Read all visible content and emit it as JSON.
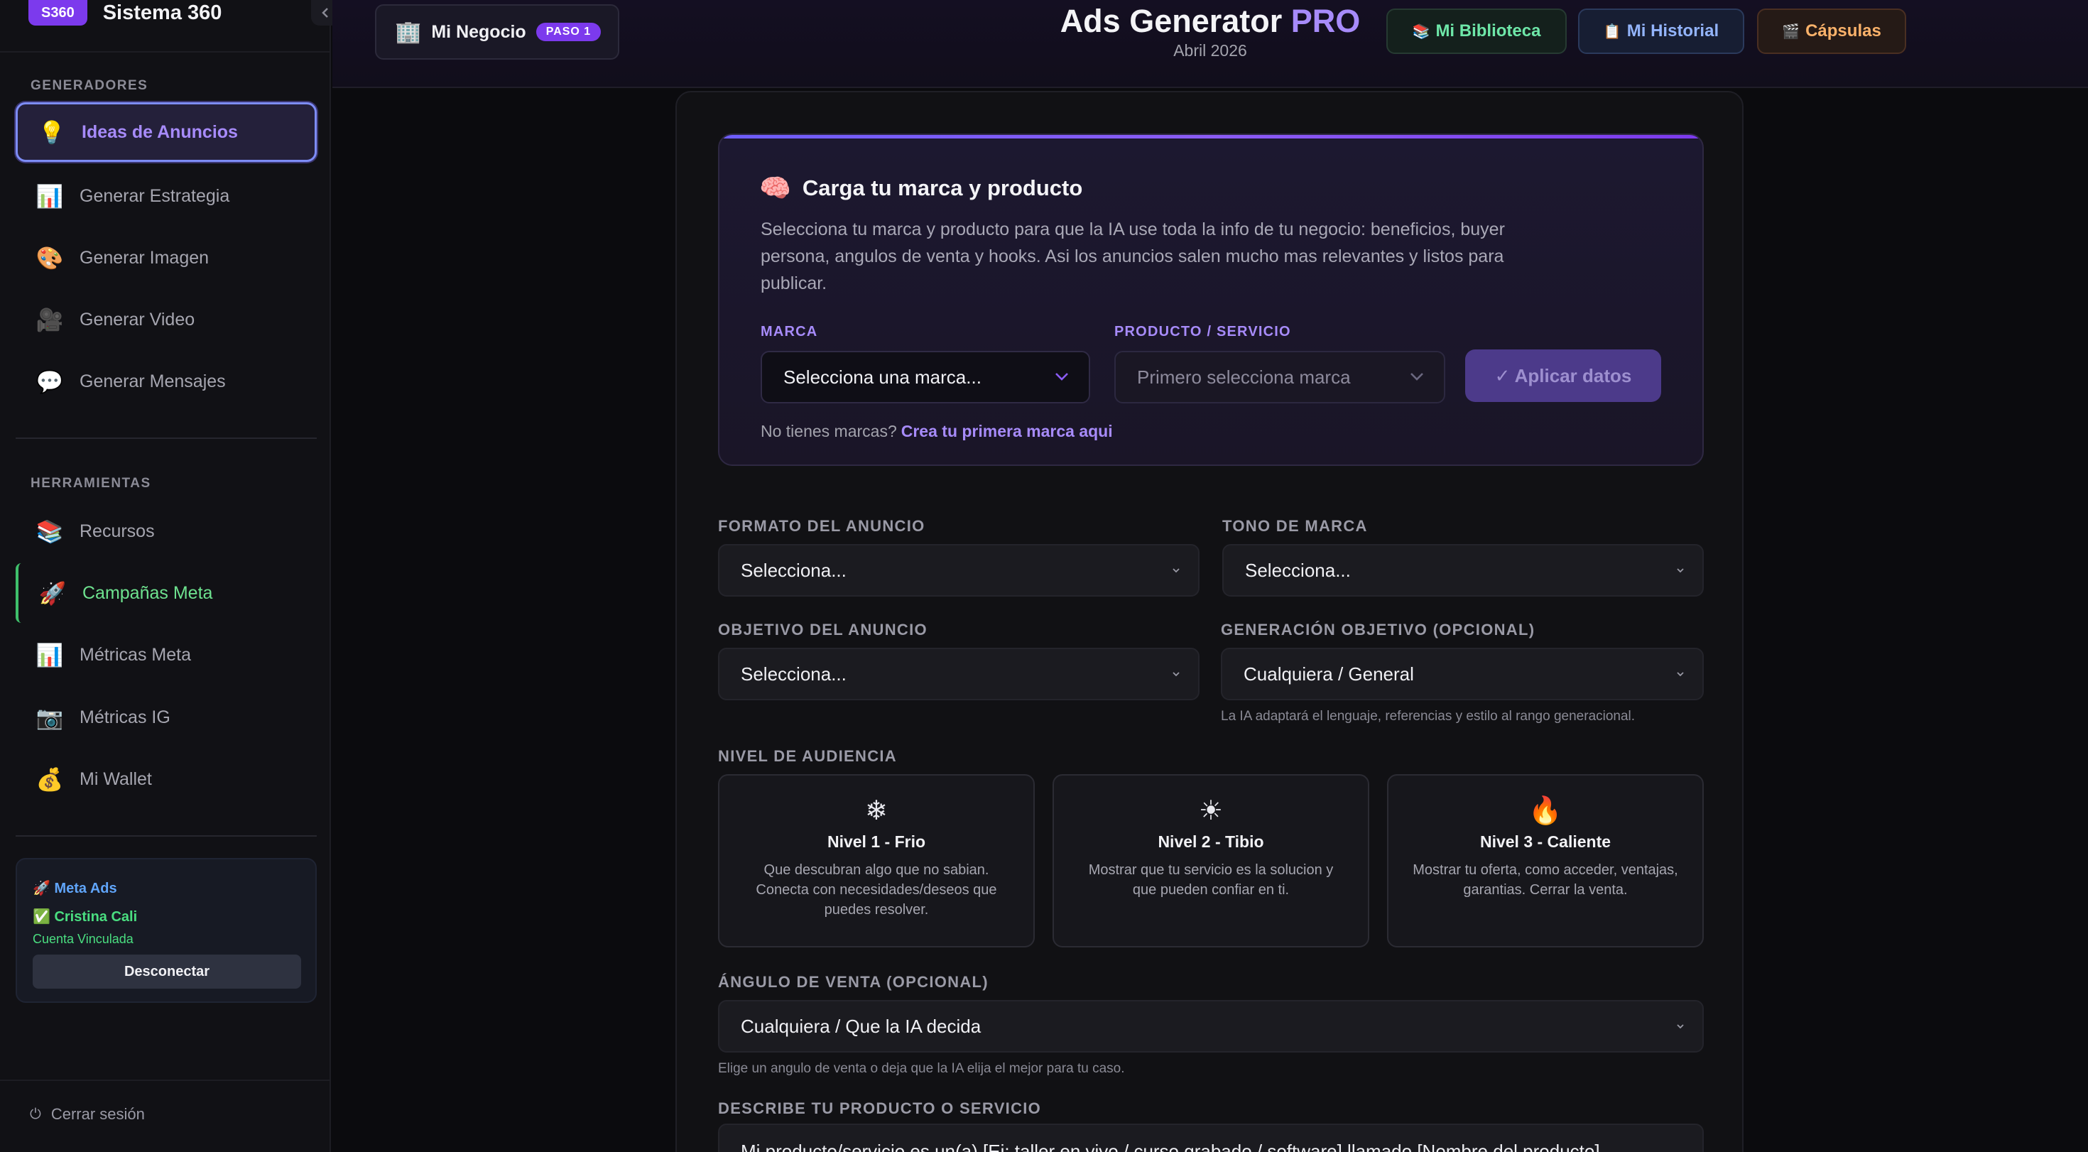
{
  "sidebar": {
    "brand_badge": "S360",
    "brand_name": "Sistema 360",
    "collapse_icon": "chevron-left-icon",
    "section_generators": "GENERADORES",
    "generators": [
      {
        "icon": "💡",
        "label": "Ideas de Anuncios",
        "active": true
      },
      {
        "icon": "📊",
        "label": "Generar Estrategia"
      },
      {
        "icon": "🎨",
        "label": "Generar Imagen"
      },
      {
        "icon": "🎥",
        "label": "Generar Video"
      },
      {
        "icon": "💬",
        "label": "Generar Mensajes"
      }
    ],
    "section_tools": "HERRAMIENTAS",
    "tools": [
      {
        "icon": "📚",
        "label": "Recursos"
      },
      {
        "icon": "🚀",
        "label": "Campañas Meta"
      },
      {
        "icon": "📊",
        "label": "Métricas Meta"
      },
      {
        "icon": "📷",
        "label": "Métricas IG"
      },
      {
        "icon": "💰",
        "label": "Mi Wallet"
      }
    ],
    "meta_card": {
      "title": "🚀 Meta Ads",
      "user": "✅ Cristina Cali",
      "status": "Cuenta Vinculada",
      "disconnect": "Desconectar"
    },
    "logout": "Cerrar sesión",
    "logout_icon": "⏻"
  },
  "topbar": {
    "biz_icon": "🏢",
    "biz_label": "Mi Negocio",
    "step_badge": "PASO 1",
    "title_main": "Ads Generator ",
    "title_pro": "PRO",
    "subtitle": "Abril 2026",
    "buttons": [
      {
        "icon": "📚",
        "label": "Mi Biblioteca"
      },
      {
        "icon": "📋",
        "label": "Mi Historial"
      },
      {
        "icon": "🎬",
        "label": "Cápsulas"
      }
    ]
  },
  "brand_card": {
    "icon": "🧠",
    "title": "Carga tu marca y producto",
    "description": "Selecciona tu marca y producto para que la IA use toda la info de tu negocio: beneficios, buyer persona, angulos de venta y hooks. Asi los anuncios salen mucho mas relevantes y listos para publicar.",
    "brand_label": "MARCA",
    "brand_value": "Selecciona una marca...",
    "product_label": "PRODUCTO / SERVICIO",
    "product_value": "Primero selecciona marca",
    "apply_label": "✓ Aplicar datos",
    "no_brands_text": "No tienes marcas?",
    "no_brands_link": "Crea tu primera marca aqui"
  },
  "form": {
    "format_label": "FORMATO DEL ANUNCIO",
    "format_value": "Selecciona...",
    "tone_label": "TONO DE MARCA",
    "tone_value": "Selecciona...",
    "objective_label": "OBJETIVO DEL ANUNCIO",
    "objective_value": "Selecciona...",
    "generation_label": "GENERACIÓN OBJETIVO (OPCIONAL)",
    "generation_value": "Cualquiera / General",
    "generation_hint": "La IA adaptará el lenguaje, referencias y estilo al rango generacional.",
    "audience_label": "NIVEL DE AUDIENCIA",
    "audience_levels": [
      {
        "icon": "❄",
        "title": "Nivel 1 - Frio",
        "desc": "Que descubran algo que no sabian. Conecta con necesidades/deseos que puedes resolver."
      },
      {
        "icon": "☀",
        "title": "Nivel 2 - Tibio",
        "desc": "Mostrar que tu servicio es la solucion y que pueden confiar en ti."
      },
      {
        "icon": "🔥",
        "title": "Nivel 3 - Caliente",
        "desc": "Mostrar tu oferta, como acceder, ventajas, garantias. Cerrar la venta."
      }
    ],
    "angle_label": "ÁNGULO DE VENTA (OPCIONAL)",
    "angle_value": "Cualquiera / Que la IA decida",
    "angle_hint": "Elige un angulo de venta o deja que la IA elija el mejor para tu caso.",
    "describe_label": "DESCRIBE TU PRODUCTO O SERVICIO",
    "describe_value": "Mi producto/servicio es un(a) [Ej: taller en vivo / curso grabado / software] llamado [Nombre del producto]"
  }
}
